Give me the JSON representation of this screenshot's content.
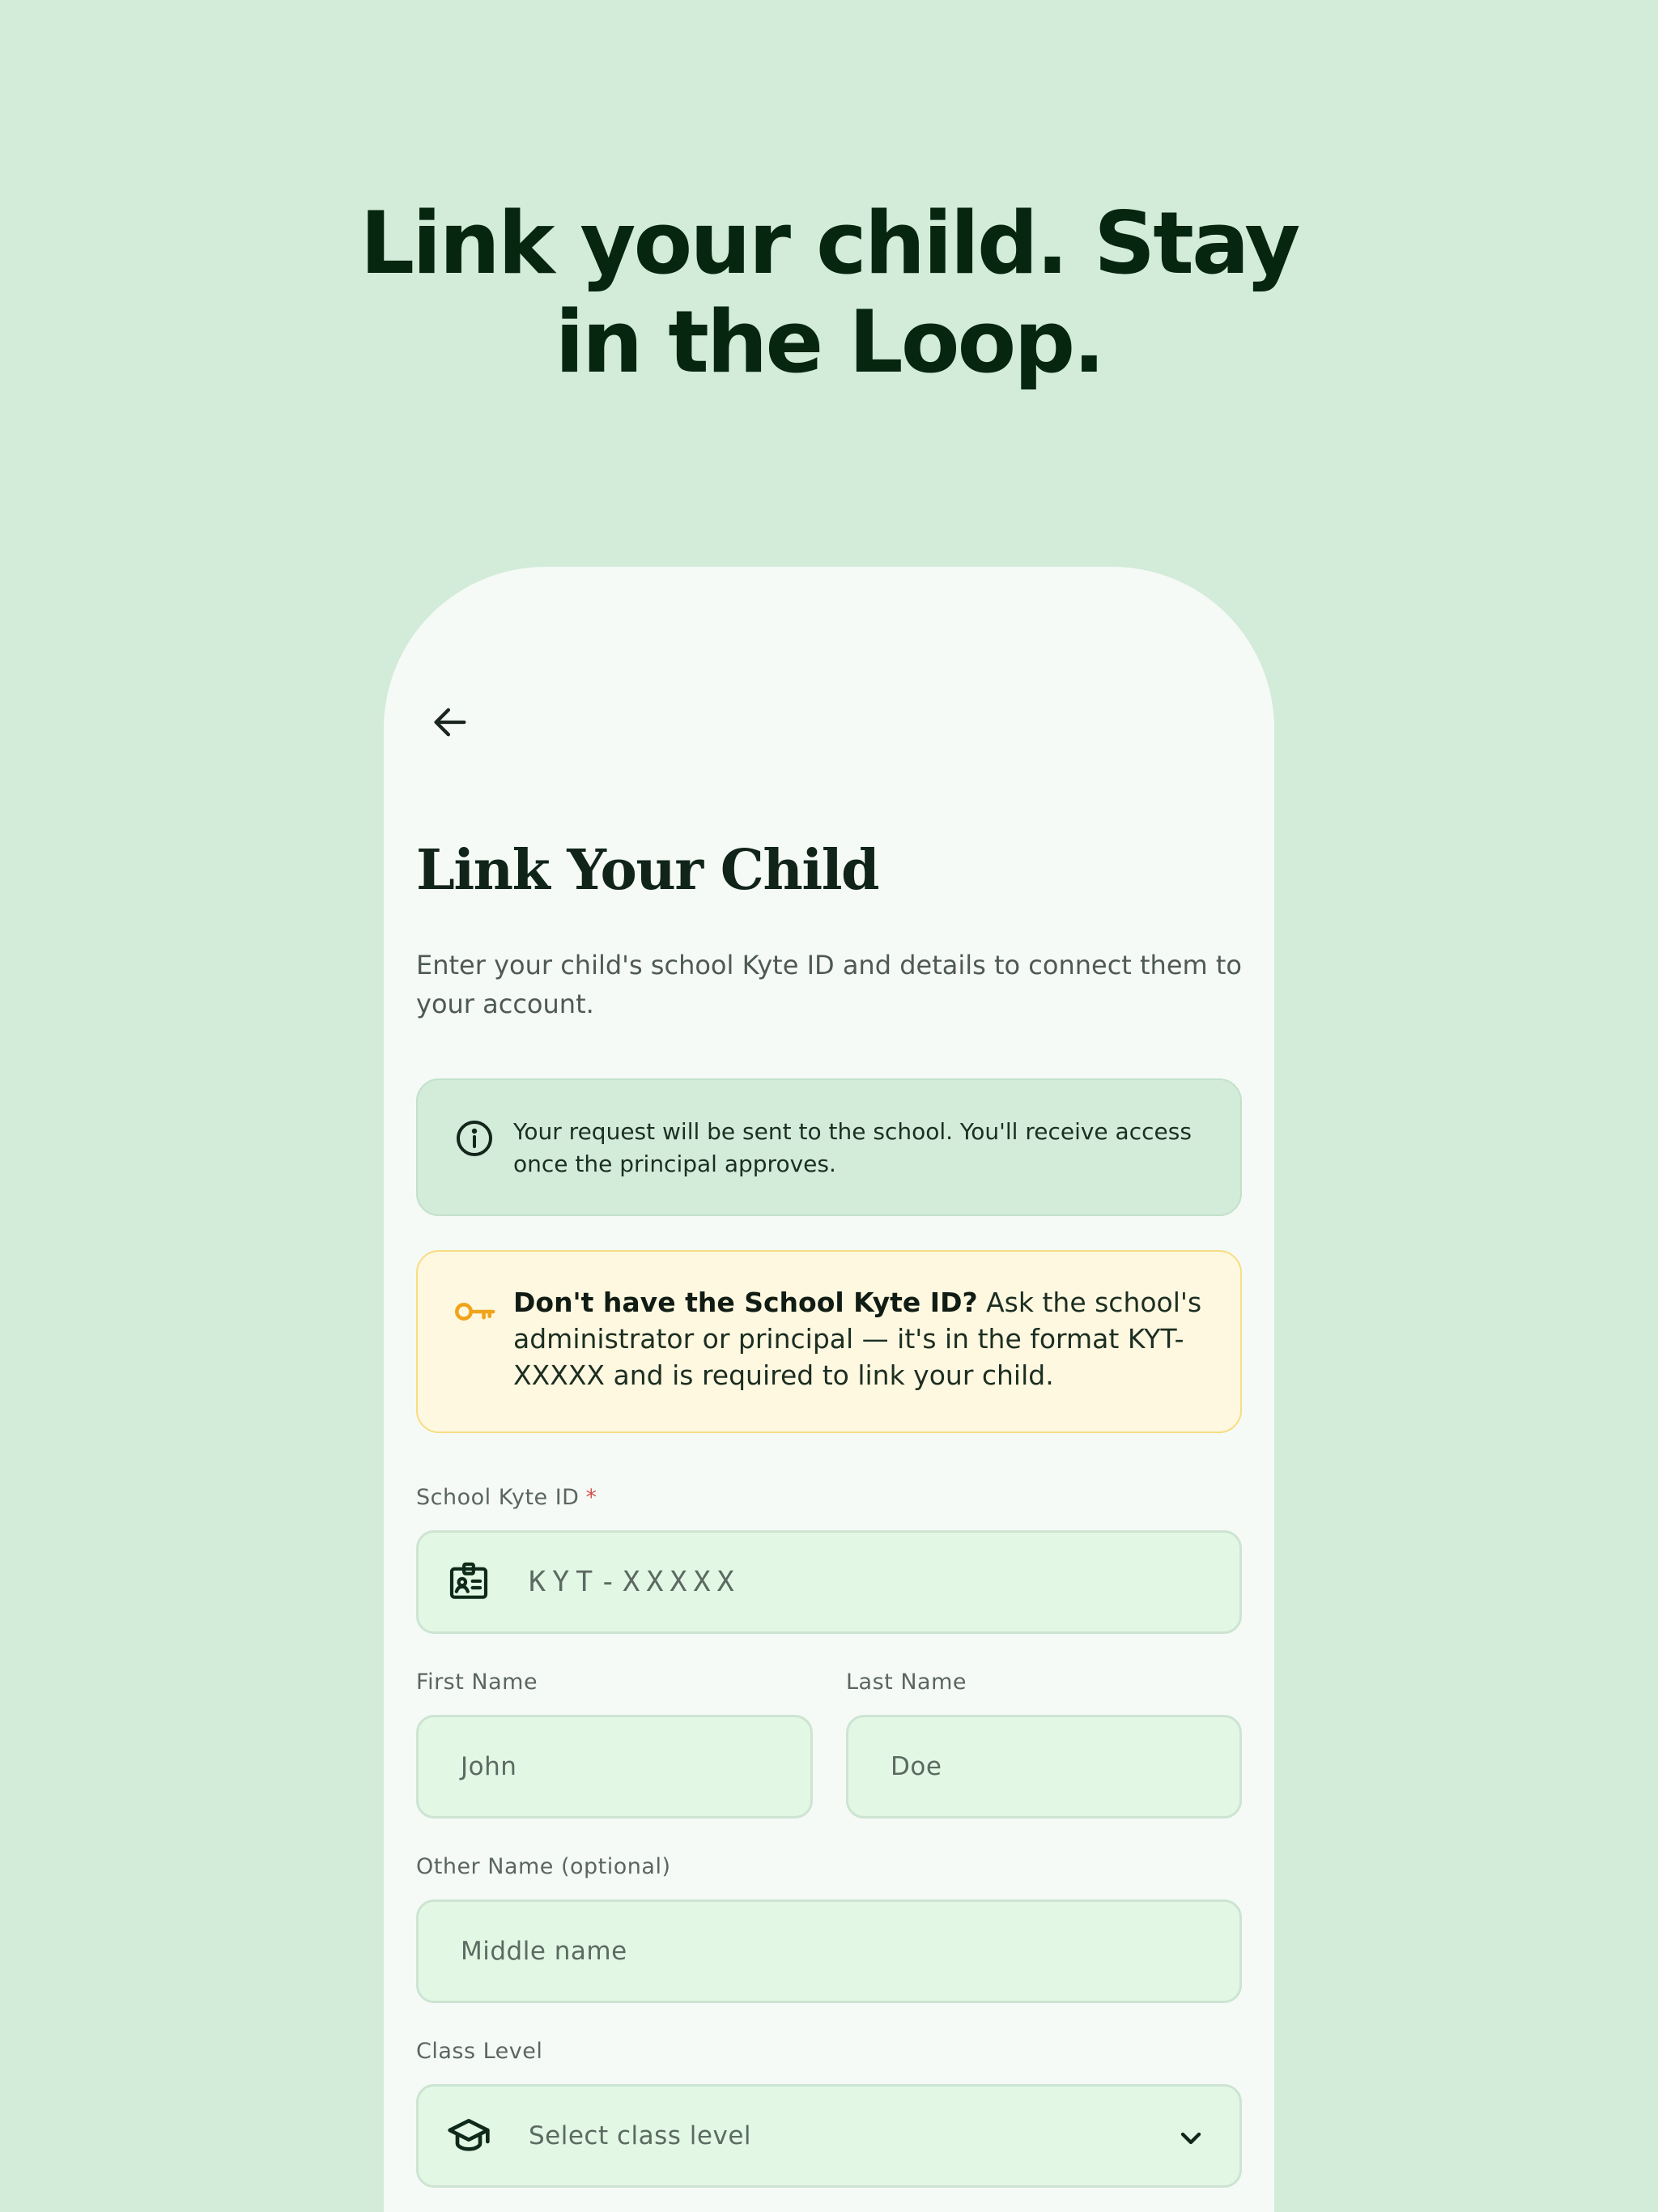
{
  "hero": {
    "line1": "Link your child. Stay",
    "line2": "in the Loop."
  },
  "screen": {
    "back_icon": "arrow-left-icon",
    "title": "Link Your Child",
    "subtitle": "Enter your child's school Kyte ID and details to connect them to your account.",
    "info": {
      "icon": "info-circle-icon",
      "text": "Your request will be sent to the school. You'll receive access once the principal approves."
    },
    "warning": {
      "icon": "key-icon",
      "bold": "Don't have the School Kyte ID?",
      "text": " Ask the school's administrator or principal — it's in the format KYT-XXXXX and is required to link your child."
    },
    "form": {
      "kyte_id": {
        "label": "School Kyte ID",
        "required_mark": "*",
        "placeholder": "KYT-XXXXX",
        "icon": "id-badge-icon"
      },
      "first_name": {
        "label": "First Name",
        "placeholder": "John"
      },
      "last_name": {
        "label": "Last Name",
        "placeholder": "Doe"
      },
      "other_name": {
        "label": "Other Name (optional)",
        "placeholder": "Middle name"
      },
      "class_level": {
        "label": "Class Level",
        "placeholder": "Select class level",
        "icon": "graduation-cap-icon",
        "dropdown_icon": "chevron-down-icon"
      }
    }
  },
  "colors": {
    "background": "#d3ebd9",
    "card": "#f5faf6",
    "info_bg": "#d2ecd9",
    "warning_bg": "#fff8e0",
    "warning_border": "#f7dd82",
    "key_accent": "#f0a41c",
    "field_bg": "#e2f8e5",
    "heading": "#06260f"
  }
}
